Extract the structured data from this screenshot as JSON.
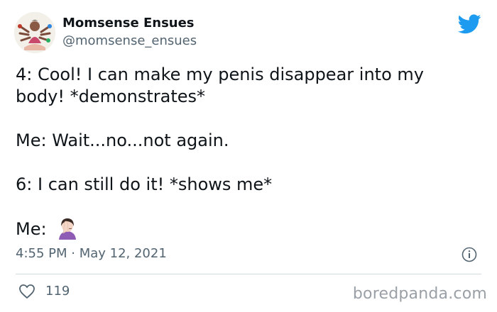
{
  "author": {
    "name": "Momsense Ensues",
    "handle": "@momsense_ensues"
  },
  "tweet": {
    "paragraphs": [
      "4: Cool! I can make my penis disappear into my body! *demonstrates*",
      "Me: Wait...no...not again.",
      "6: I can still do it! *shows me*"
    ],
    "last_line_prefix": "Me:",
    "emoji": "woman-facepalming-icon",
    "timestamp": "4:55 PM · May 12, 2021"
  },
  "engagement": {
    "like_count": "119"
  },
  "watermark": "boredpanda.com",
  "colors": {
    "text": "#0f1419",
    "secondary": "#536471",
    "twitter_blue": "#1d9bf0",
    "watermark": "#9aa0a6"
  }
}
